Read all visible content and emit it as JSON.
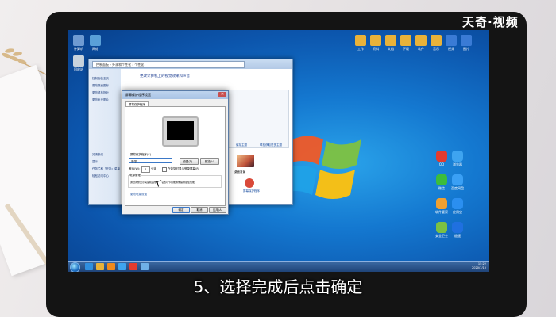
{
  "watermark": "天奇·视频",
  "subtitle": "5、选择完成后点击确定",
  "notebook_text": "...",
  "desktop": {
    "right_icons": [
      {
        "label": "QQ",
        "color": "#e33b2e"
      },
      {
        "label": "浏览器",
        "color": "#3ea4f0"
      },
      {
        "label": "微信",
        "color": "#3cbd3c"
      },
      {
        "label": "百度网盘",
        "color": "#3aa0f5"
      },
      {
        "label": "软件管家",
        "color": "#f0a030"
      },
      {
        "label": "应用宝",
        "color": "#2b8ff0"
      },
      {
        "label": "安全卫士",
        "color": "#7bc043"
      },
      {
        "label": "极速",
        "color": "#1f70e0"
      }
    ],
    "top_icons": [
      {
        "label": "工作",
        "color": "#e8b23a"
      },
      {
        "label": "资料",
        "color": "#e8b23a"
      },
      {
        "label": "文档",
        "color": "#e8b23a"
      },
      {
        "label": "下载",
        "color": "#e8b23a"
      },
      {
        "label": "软件",
        "color": "#e8b23a"
      },
      {
        "label": "音乐",
        "color": "#e8b23a"
      },
      {
        "label": "视频",
        "color": "#3a7bd5"
      },
      {
        "label": "图片",
        "color": "#3a7bd5"
      }
    ],
    "left_icons": [
      {
        "label": "计算机",
        "color": "#6f9bd2"
      },
      {
        "label": "网络",
        "color": "#5aa0d8"
      },
      {
        "label": "回收站",
        "color": "#c8d3dd"
      }
    ]
  },
  "explorer": {
    "address": "控制面板 › 外观和个性化 › 个性化",
    "heading": "更改计算机上的视觉效果和声音",
    "sidebar": [
      "控制面板主页",
      "更改桌面图标",
      "更改鼠标指针",
      "更改帐户图片"
    ],
    "sidebar_bottom": [
      "另请参阅",
      "显示",
      "任务栏和「开始」菜单",
      "轻松访问中心"
    ],
    "links": [
      "保存主题",
      "联机获取更多主题"
    ],
    "thumb_label": "桌面背景",
    "bottom_items": [
      "窗口颜色",
      "声音",
      "屏幕保护程序"
    ]
  },
  "dialog": {
    "title": "屏幕保护程序设置",
    "tab": "屏幕保护程序",
    "section_label": "屏幕保护程序(S)",
    "selected": "彩带",
    "settings_btn": "设置(T)...",
    "preview_btn": "预览(V)",
    "wait_label": "等待(W):",
    "wait_value": "1",
    "minutes": "分钟",
    "resume_label": "在恢复时显示登录屏幕(R)",
    "power_label": "电源管理",
    "power_text": "通过调整显示亮度和其他电源设置以节省能源或提供最佳性能。",
    "power_link": "更改电源设置",
    "ok": "确定",
    "cancel": "取消",
    "apply": "应用(A)"
  },
  "taskbar": {
    "time": "15:22",
    "date": "2020/1/10",
    "apps": [
      {
        "name": "ie",
        "color": "#2f8fe0"
      },
      {
        "name": "folder",
        "color": "#e8b23a"
      },
      {
        "name": "media",
        "color": "#f08a1c"
      },
      {
        "name": "browser",
        "color": "#3ea4f0"
      },
      {
        "name": "qq",
        "color": "#e33b2e"
      },
      {
        "name": "control-panel",
        "color": "#6fb0e8"
      }
    ]
  }
}
